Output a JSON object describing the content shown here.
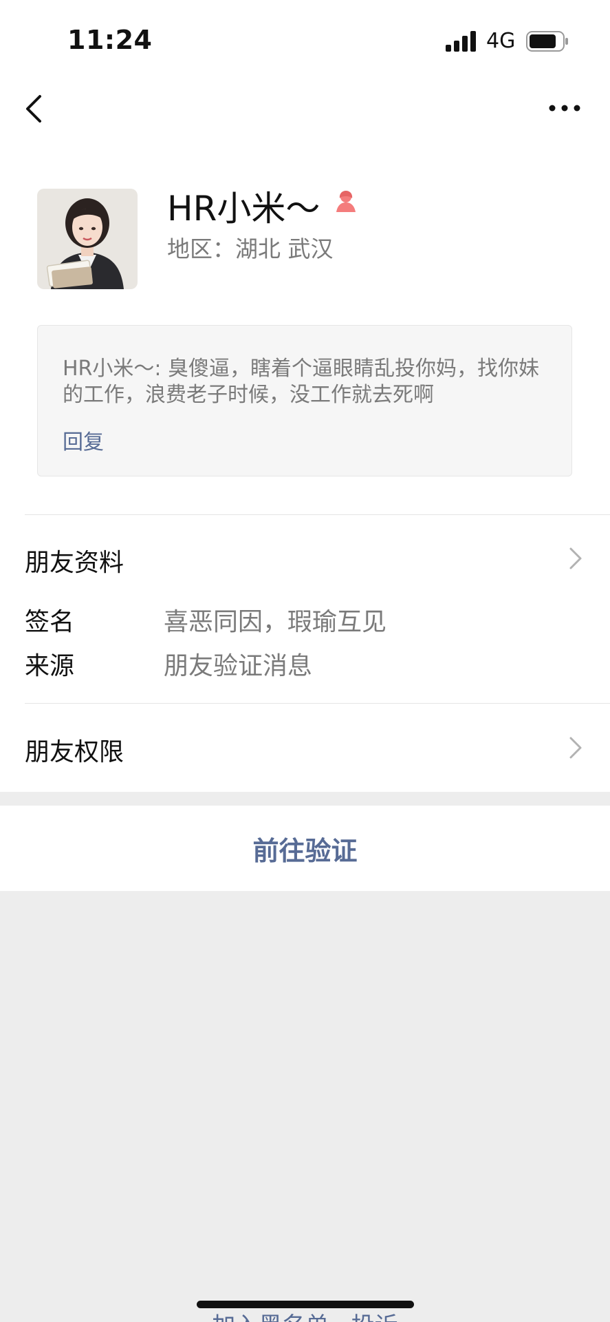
{
  "status_bar": {
    "time": "11:24",
    "network": "4G"
  },
  "nav": {
    "back_icon": "chevron-left-icon",
    "more_icon": "more-dots-icon"
  },
  "profile": {
    "name": "HR小米～",
    "gender_icon": "female-user-icon",
    "gender_color": "#f47c7c",
    "region": "地区：湖北 武汉"
  },
  "message": {
    "text": "HR小米～: 臭傻逼，瞎着个逼眼睛乱投你妈，找你妹的工作，浪费老子时候，没工作就去死啊",
    "reply_label": "回复"
  },
  "sections": {
    "friend_profile": "朋友资料",
    "signature_label": "签名",
    "signature_value": "喜恶同因，瑕瑜互见",
    "source_label": "来源",
    "source_value": "朋友验证消息",
    "friend_permissions": "朋友权限"
  },
  "actions": {
    "verify_button": "前往验证",
    "bottom_link": "加入黑名单 · 投诉"
  },
  "colors": {
    "link": "#576b95",
    "secondary_text": "#7a7a7a",
    "background": "#ededed"
  }
}
